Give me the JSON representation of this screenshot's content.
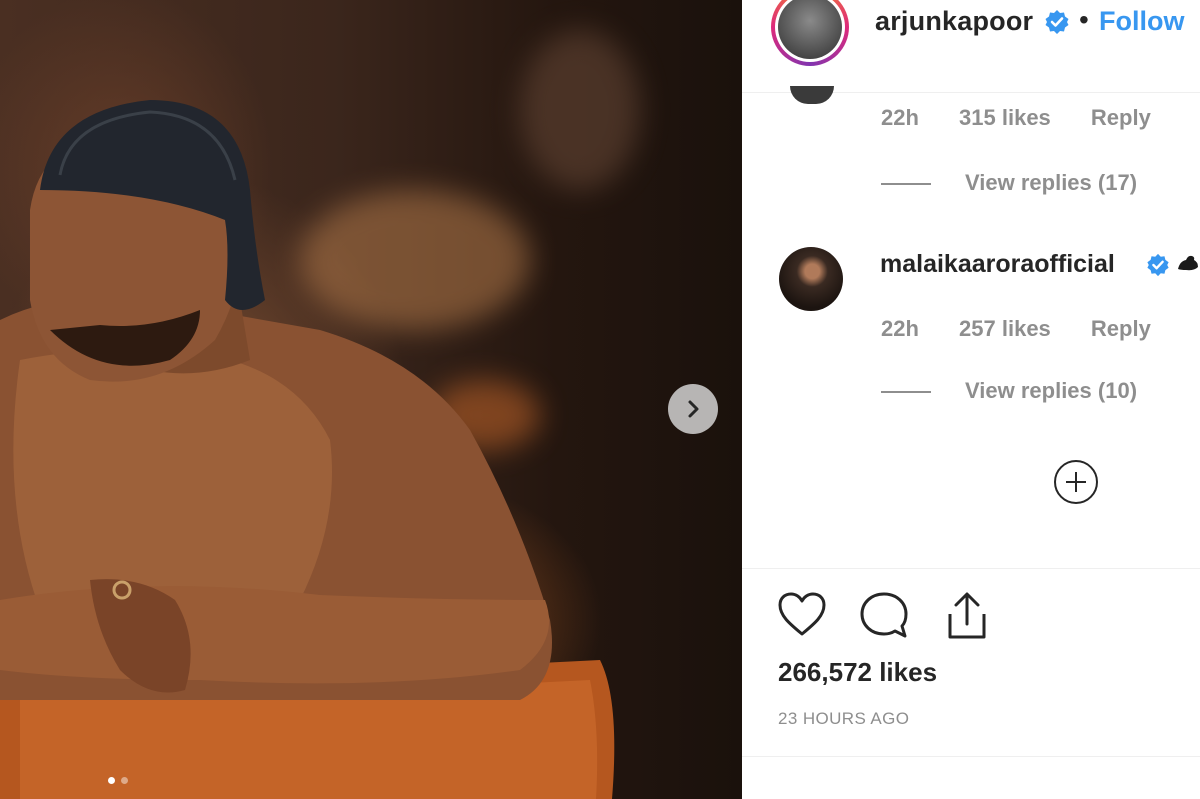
{
  "post": {
    "author": "arjunkapoor",
    "separator": "•",
    "follow_label": "Follow",
    "likes": "266,572 likes",
    "timestamp": "23 HOURS AGO",
    "carousel_index": 1,
    "carousel_count": 2
  },
  "comments": [
    {
      "time": "22h",
      "likes": "315 likes",
      "reply_label": "Reply",
      "view_replies": "View replies (17)"
    },
    {
      "username": "malaikaaroraofficial",
      "emoji": "muscle-emoji",
      "time": "22h",
      "likes": "257 likes",
      "reply_label": "Reply",
      "view_replies": "View replies (10)"
    }
  ],
  "icons": {
    "verified": "verified-badge-icon",
    "next": "chevron-right-icon",
    "load_more": "plus-circle-icon",
    "like": "heart-icon",
    "comment": "comment-bubble-icon",
    "share": "share-icon"
  },
  "colors": {
    "link_blue": "#3897f0",
    "verified_blue": "#3897f0",
    "muted": "#8e8e8e",
    "text": "#262626"
  }
}
